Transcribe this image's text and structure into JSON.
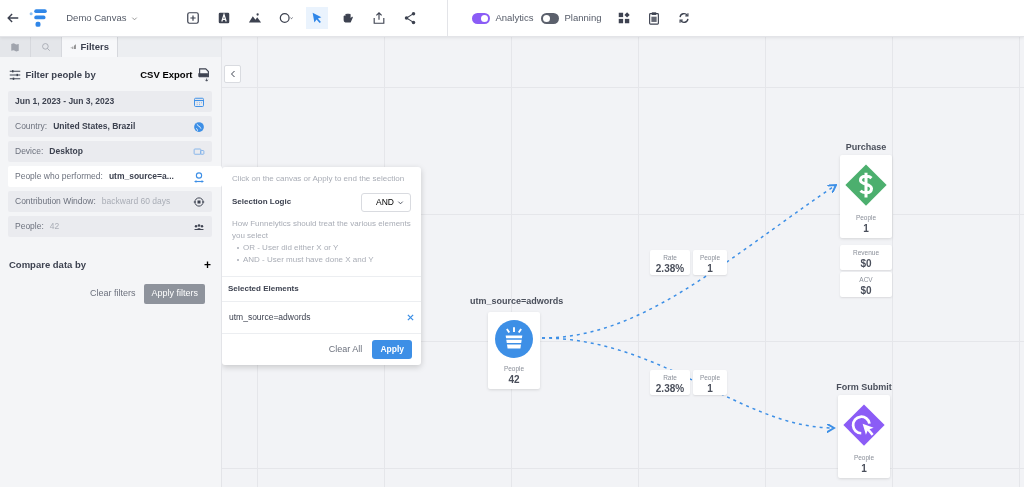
{
  "header": {
    "title": "Demo Canvas",
    "tools": [
      {
        "kind": "add",
        "selected": false
      },
      {
        "kind": "text",
        "selected": false
      },
      {
        "kind": "image",
        "selected": false
      },
      {
        "kind": "shape",
        "selected": false
      },
      {
        "kind": "pointer",
        "selected": true
      },
      {
        "kind": "hand",
        "selected": false
      },
      {
        "kind": "upload",
        "selected": false
      },
      {
        "kind": "share",
        "selected": false
      }
    ],
    "toggles": [
      {
        "label": "Analytics",
        "on": true
      },
      {
        "label": "Planning",
        "on": false
      }
    ],
    "actions": [
      {
        "kind": "widgets"
      },
      {
        "kind": "clipboard"
      },
      {
        "kind": "refresh"
      }
    ]
  },
  "sidebar": {
    "tabs": [
      {
        "kind": "map",
        "selected": false
      },
      {
        "kind": "search",
        "selected": false
      },
      {
        "kind": "filters",
        "label": "Filters",
        "selected": true
      }
    ],
    "heading": "Filter people by",
    "export": "CSV Export",
    "filters": [
      {
        "kind": "date",
        "value": "Jun 1, 2023 - Jun 3, 2023",
        "value_bold": true,
        "selected": false
      },
      {
        "kind": "country",
        "label": "Country:",
        "value": "United States, Brazil",
        "value_bold": true,
        "selected": false
      },
      {
        "kind": "device",
        "label": "Device:",
        "value": "Desktop",
        "value_bold": true,
        "selected": false
      },
      {
        "kind": "event",
        "label": "People who performed:",
        "value": "utm_source=a...",
        "value_bold": true,
        "selected": true
      },
      {
        "kind": "window",
        "label": "Contribution Window:",
        "value": "backward 60 days",
        "value_bold": false,
        "selected": false
      },
      {
        "kind": "people",
        "label": "People:",
        "value": "42",
        "value_bold": false,
        "selected": false
      }
    ],
    "compare": "Compare data by",
    "compare_add": "+",
    "buttons": [
      {
        "label": "Clear filters",
        "kind": "link",
        "disabled": false
      },
      {
        "label": "Apply filters",
        "kind": "solid",
        "disabled": true
      }
    ]
  },
  "popover": {
    "hint": "Click on the canvas or Apply to end the selection",
    "logic_label": "Selection Logic",
    "logic_value": "AND",
    "description": "How Funnelytics should treat the various elements you select",
    "bullets": [
      "OR - User did either X or Y",
      "AND - User must have done X and Y"
    ],
    "selected_heading": "Selected Elements",
    "elements": [
      "utm_source=adwords"
    ],
    "buttons": [
      {
        "label": "Clear All",
        "kind": "link"
      },
      {
        "label": "Apply",
        "kind": "solid"
      }
    ]
  },
  "canvas": {
    "nodes": [
      {
        "kind": "source",
        "title": "utm_source=adwords",
        "metrics": [
          {
            "label": "People",
            "value": "42"
          }
        ]
      },
      {
        "kind": "purchase",
        "title": "Purchase",
        "metrics": [
          {
            "label": "People",
            "value": "1"
          },
          {
            "label": "Revenue",
            "value": "$0"
          },
          {
            "label": "ACV",
            "value": "$0"
          }
        ]
      },
      {
        "kind": "form",
        "title": "Form Submit",
        "metrics": [
          {
            "label": "People",
            "value": "1"
          }
        ]
      }
    ],
    "edges": [
      {
        "rate_label": "Rate",
        "rate": "2.38%",
        "people_label": "People",
        "people": "1"
      },
      {
        "rate_label": "Rate",
        "rate": "2.38%",
        "people_label": "People",
        "people": "1"
      }
    ]
  }
}
